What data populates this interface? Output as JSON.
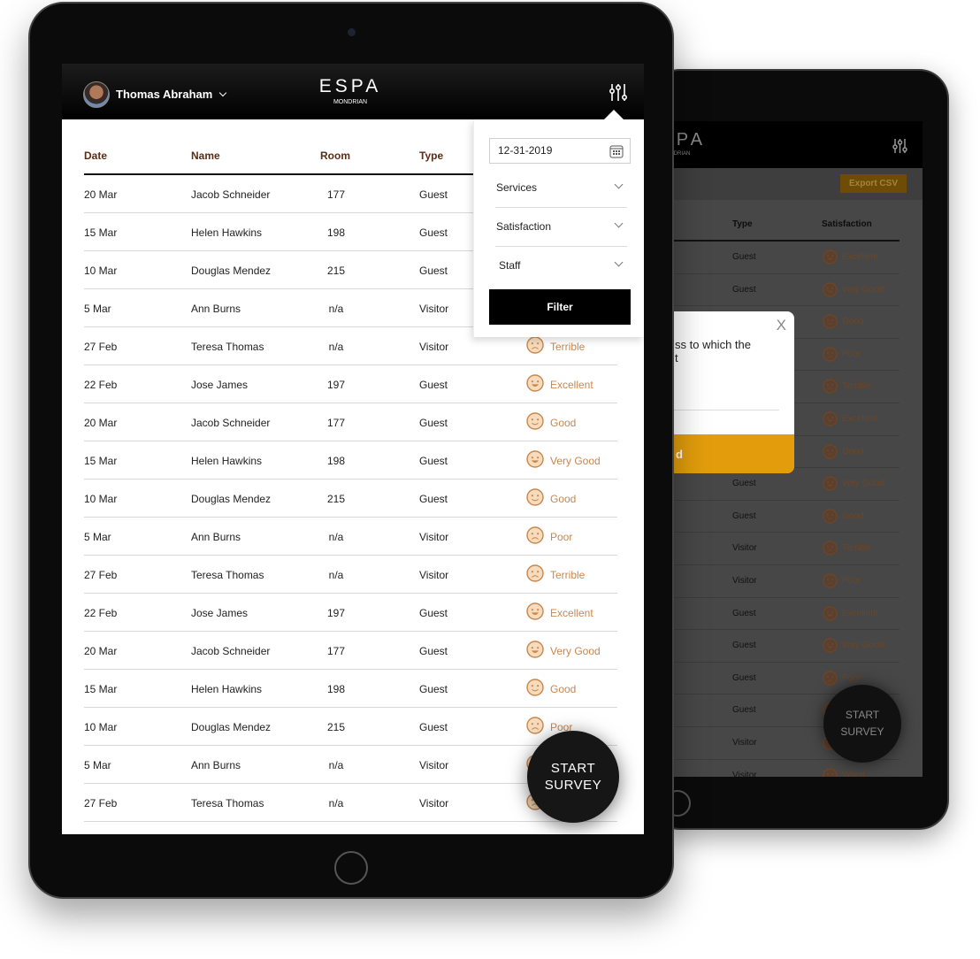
{
  "brand": {
    "name": "ESPA",
    "sub": "MONDRIAN"
  },
  "user": {
    "name": "Thomas Abraham"
  },
  "colors": {
    "accent": "#e39d0c",
    "satisfaction": "#c8874f",
    "header": "#000000",
    "column_header": "#5a2d16"
  },
  "table": {
    "headers": {
      "date": "Date",
      "name": "Name",
      "room": "Room",
      "type": "Type",
      "satisfaction": "Satisfaction"
    },
    "rows": [
      {
        "date": "20 Mar",
        "name": "Jacob Schneider",
        "room": "177",
        "type": "Guest",
        "satisfaction": ""
      },
      {
        "date": "15 Mar",
        "name": "Helen Hawkins",
        "room": "198",
        "type": "Guest",
        "satisfaction": ""
      },
      {
        "date": "10 Mar",
        "name": "Douglas Mendez",
        "room": "215",
        "type": "Guest",
        "satisfaction": ""
      },
      {
        "date": "5 Mar",
        "name": "Ann Burns",
        "room": "n/a",
        "type": "Visitor",
        "satisfaction": ""
      },
      {
        "date": "27 Feb",
        "name": "Teresa Thomas",
        "room": "n/a",
        "type": "Visitor",
        "satisfaction": "Terrible"
      },
      {
        "date": "22 Feb",
        "name": "Jose James",
        "room": "197",
        "type": "Guest",
        "satisfaction": "Excellent"
      },
      {
        "date": "20 Mar",
        "name": "Jacob Schneider",
        "room": "177",
        "type": "Guest",
        "satisfaction": "Good"
      },
      {
        "date": "15 Mar",
        "name": "Helen Hawkins",
        "room": "198",
        "type": "Guest",
        "satisfaction": "Very Good"
      },
      {
        "date": "10 Mar",
        "name": "Douglas Mendez",
        "room": "215",
        "type": "Guest",
        "satisfaction": "Good"
      },
      {
        "date": "5 Mar",
        "name": "Ann Burns",
        "room": "n/a",
        "type": "Visitor",
        "satisfaction": "Poor"
      },
      {
        "date": "27 Feb",
        "name": "Teresa Thomas",
        "room": "n/a",
        "type": "Visitor",
        "satisfaction": "Terrible"
      },
      {
        "date": "22 Feb",
        "name": "Jose James",
        "room": "197",
        "type": "Guest",
        "satisfaction": "Excellent"
      },
      {
        "date": "20 Mar",
        "name": "Jacob Schneider",
        "room": "177",
        "type": "Guest",
        "satisfaction": "Very Good"
      },
      {
        "date": "15 Mar",
        "name": "Helen Hawkins",
        "room": "198",
        "type": "Guest",
        "satisfaction": "Good"
      },
      {
        "date": "10 Mar",
        "name": "Douglas Mendez",
        "room": "215",
        "type": "Guest",
        "satisfaction": "Poor"
      },
      {
        "date": "5 Mar",
        "name": "Ann Burns",
        "room": "n/a",
        "type": "Visitor",
        "satisfaction": ""
      },
      {
        "date": "27 Feb",
        "name": "Teresa Thomas",
        "room": "n/a",
        "type": "Visitor",
        "satisfaction": ""
      }
    ]
  },
  "filter": {
    "date": "12-31-2019",
    "selects": [
      "Services",
      "Satisfaction",
      "Staff"
    ],
    "button": "Filter"
  },
  "start_survey": {
    "line1": "START",
    "line2": "SURVEY"
  },
  "back_screen": {
    "export_label": "Export CSV",
    "headers": {
      "type": "Type",
      "satisfaction": "Satisfaction"
    },
    "rows": [
      {
        "type": "Guest",
        "satisfaction": "Excellent"
      },
      {
        "type": "Guest",
        "satisfaction": "Very Good"
      },
      {
        "type": "",
        "satisfaction": "Good"
      },
      {
        "type": "",
        "satisfaction": "Poor"
      },
      {
        "type": "",
        "satisfaction": "Terrible"
      },
      {
        "type": "",
        "satisfaction": "Excellent"
      },
      {
        "type": "",
        "satisfaction": "Good"
      },
      {
        "type": "Guest",
        "satisfaction": "Very Good"
      },
      {
        "type": "Guest",
        "satisfaction": "Good"
      },
      {
        "type": "Visitor",
        "satisfaction": "Terrible"
      },
      {
        "type": "Visitor",
        "satisfaction": "Poor"
      },
      {
        "type": "Guest",
        "satisfaction": "Excellent"
      },
      {
        "type": "Guest",
        "satisfaction": "Very Good"
      },
      {
        "type": "Guest",
        "satisfaction": "Poor"
      },
      {
        "type": "Guest",
        "satisfaction": ""
      },
      {
        "type": "Visitor",
        "satisfaction": ""
      },
      {
        "type": "Visitor",
        "satisfaction": "Worst"
      }
    ],
    "modal": {
      "question_line1": "ss to which the",
      "question_line2": "t",
      "button": "d",
      "close": "X"
    }
  }
}
